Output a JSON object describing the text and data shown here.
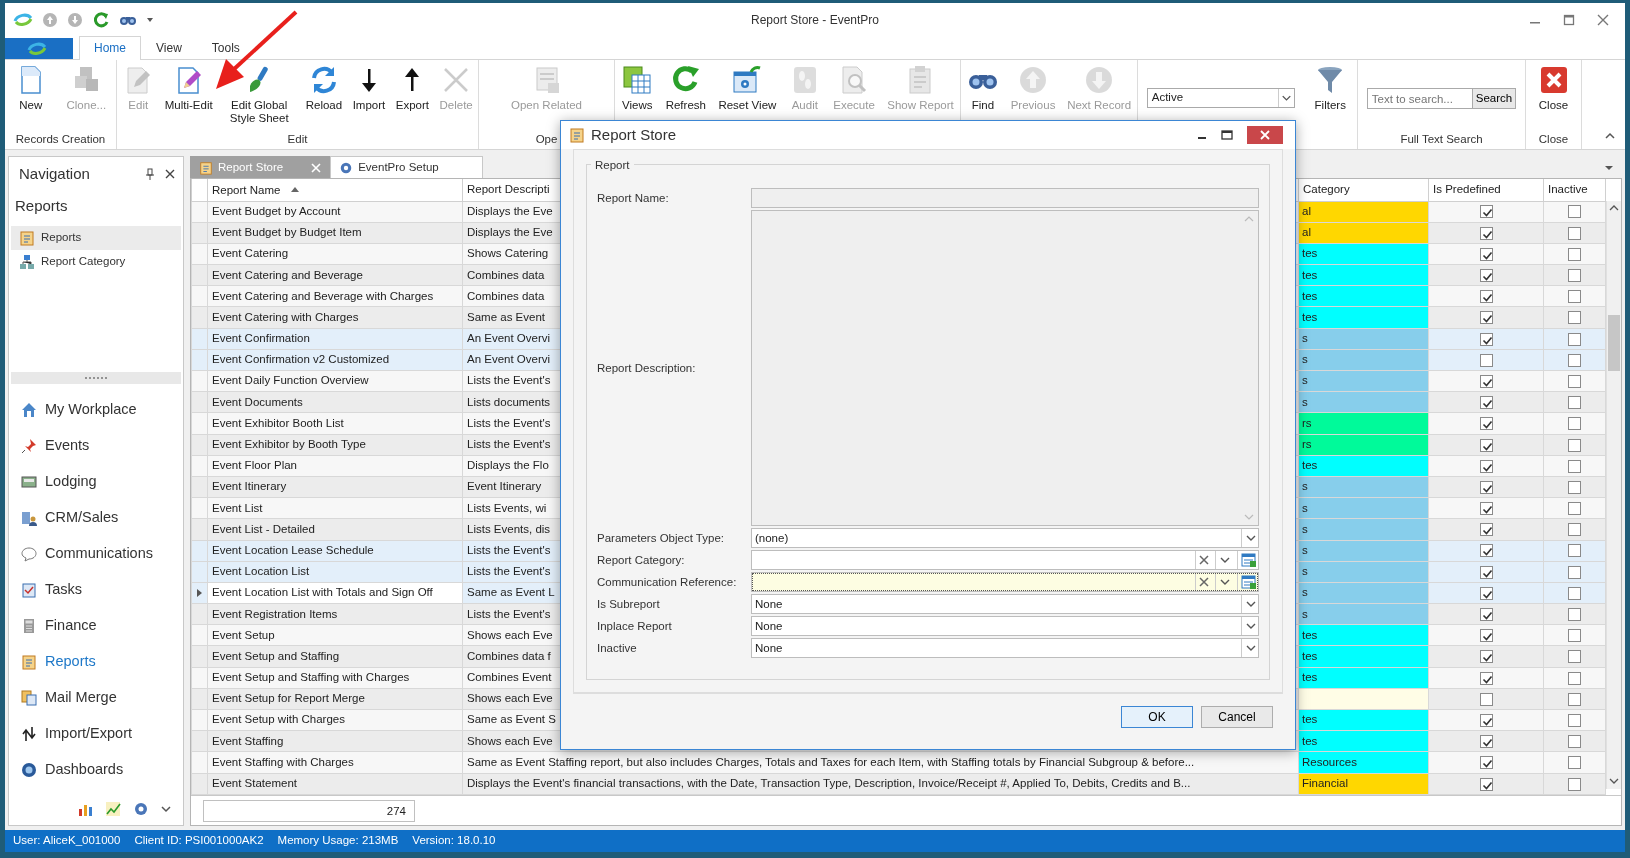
{
  "window": {
    "title": "Report Store - EventPro"
  },
  "ribbon": {
    "tabs": [
      {
        "label": "Home",
        "selected": true
      },
      {
        "label": "View",
        "selected": false
      },
      {
        "label": "Tools",
        "selected": false
      }
    ],
    "groups": [
      {
        "label": "Records Creation",
        "buttons": [
          {
            "label": "New",
            "disabled": false
          },
          {
            "label": "Clone...",
            "disabled": true
          }
        ]
      },
      {
        "label": "Edit",
        "buttons": [
          {
            "label": "Edit",
            "disabled": true
          },
          {
            "label": "Multi-Edit",
            "disabled": false
          },
          {
            "label": "Edit Global Style Sheet",
            "disabled": false
          },
          {
            "label": "Reload",
            "disabled": false
          },
          {
            "label": "Import",
            "disabled": false
          },
          {
            "label": "Export",
            "disabled": false
          },
          {
            "label": "Delete",
            "disabled": true
          }
        ]
      },
      {
        "label": "Ope",
        "buttons": [
          {
            "label": "Open Related",
            "disabled": true
          }
        ]
      },
      {
        "buttons": [
          {
            "label": "Views",
            "disabled": false
          },
          {
            "label": "Refresh",
            "disabled": false
          },
          {
            "label": "Reset View",
            "disabled": false
          },
          {
            "label": "Audit",
            "disabled": true
          },
          {
            "label": "Execute",
            "disabled": true
          },
          {
            "label": "Show Report",
            "disabled": true
          }
        ]
      },
      {
        "buttons": [
          {
            "label": "Find",
            "disabled": false
          },
          {
            "label": "Previous",
            "disabled": true
          },
          {
            "label": "Next Record",
            "disabled": true
          }
        ]
      },
      {
        "dropdown": {
          "value": "Active"
        },
        "buttons": [
          {
            "label": "Filters",
            "disabled": false
          }
        ]
      },
      {
        "label": "Full Text Search",
        "search": {
          "placeholder": "Text to search...",
          "button": "Search"
        }
      },
      {
        "label": "Close",
        "buttons": [
          {
            "label": "Close",
            "disabled": false
          }
        ]
      }
    ]
  },
  "navigation": {
    "title": "Navigation",
    "section": "Reports",
    "items": [
      {
        "label": "Reports",
        "selected": true
      },
      {
        "label": "Report Category",
        "selected": false
      }
    ],
    "modules": [
      {
        "label": "My Workplace",
        "selected": false
      },
      {
        "label": "Events",
        "selected": false
      },
      {
        "label": "Lodging",
        "selected": false
      },
      {
        "label": "CRM/Sales",
        "selected": false
      },
      {
        "label": "Communications",
        "selected": false
      },
      {
        "label": "Tasks",
        "selected": false
      },
      {
        "label": "Finance",
        "selected": false
      },
      {
        "label": "Reports",
        "selected": true
      },
      {
        "label": "Mail Merge",
        "selected": false
      },
      {
        "label": "Import/Export",
        "selected": false
      },
      {
        "label": "Dashboards",
        "selected": false
      }
    ]
  },
  "document_tabs": [
    {
      "label": "Report Store",
      "selected": true
    },
    {
      "label": "EventPro Setup",
      "selected": false
    }
  ],
  "table": {
    "columns": [
      {
        "label": "Report Name",
        "sorted": true
      },
      {
        "label": "Report Descripti",
        "sorted": false
      },
      {
        "label": "Category",
        "sorted": false
      },
      {
        "label": "Is Predefined",
        "sorted": false
      },
      {
        "label": "Inactive",
        "sorted": false
      }
    ],
    "rows": [
      {
        "name": "Event Budget by Account",
        "description": "Displays the Eve",
        "category": "al",
        "color": "#ffd700",
        "predefined": true,
        "inactive": false,
        "selected": false,
        "current": false
      },
      {
        "name": "Event Budget by Budget Item",
        "description": "Displays the Eve",
        "category": "al",
        "color": "#ffd700",
        "predefined": true,
        "inactive": false,
        "selected": false,
        "current": false
      },
      {
        "name": "Event Catering",
        "description": "Shows Catering",
        "category": "tes",
        "color": "#00ffff",
        "predefined": true,
        "inactive": false,
        "selected": false,
        "current": false
      },
      {
        "name": "Event Catering and Beverage",
        "description": "Combines data",
        "category": "tes",
        "color": "#00ffff",
        "predefined": true,
        "inactive": false,
        "selected": false,
        "current": false
      },
      {
        "name": "Event Catering and Beverage with Charges",
        "description": "Combines data",
        "category": "tes",
        "color": "#00ffff",
        "predefined": true,
        "inactive": false,
        "selected": false,
        "current": false
      },
      {
        "name": "Event Catering with Charges",
        "description": "Same as Event",
        "category": "tes",
        "color": "#00ffff",
        "predefined": true,
        "inactive": false,
        "selected": false,
        "current": false
      },
      {
        "name": "Event Confirmation",
        "description": "An Event Overvi",
        "category": "s",
        "color": "#87ceeb",
        "predefined": true,
        "inactive": false,
        "selected": true,
        "current": false
      },
      {
        "name": "Event Confirmation v2 Customized",
        "description": "An Event Overvi",
        "category": "s",
        "color": "#87ceeb",
        "predefined": false,
        "inactive": false,
        "selected": true,
        "current": false
      },
      {
        "name": "Event Daily Function Overview",
        "description": "Lists the Event's",
        "category": "s",
        "color": "#87ceeb",
        "predefined": true,
        "inactive": false,
        "selected": false,
        "current": false
      },
      {
        "name": "Event Documents",
        "description": "Lists documents",
        "category": "s",
        "color": "#87ceeb",
        "predefined": true,
        "inactive": false,
        "selected": false,
        "current": false
      },
      {
        "name": "Event Exhibitor Booth List",
        "description": "Lists the Event's",
        "category": "rs",
        "color": "#00fa9a",
        "predefined": true,
        "inactive": false,
        "selected": false,
        "current": false
      },
      {
        "name": "Event Exhibitor by Booth Type",
        "description": "Lists the Event's",
        "category": "rs",
        "color": "#00fa9a",
        "predefined": true,
        "inactive": false,
        "selected": false,
        "current": false
      },
      {
        "name": "Event Floor Plan",
        "description": "Displays the Flo",
        "category": "tes",
        "color": "#00ffff",
        "predefined": true,
        "inactive": false,
        "selected": false,
        "current": false
      },
      {
        "name": "Event Itinerary",
        "description": "Event Itinerary",
        "category": "s",
        "color": "#87ceeb",
        "predefined": true,
        "inactive": false,
        "selected": false,
        "current": false
      },
      {
        "name": "Event List",
        "description": "Lists Events, wi",
        "category": "s",
        "color": "#87ceeb",
        "predefined": true,
        "inactive": false,
        "selected": false,
        "current": false
      },
      {
        "name": "Event List - Detailed",
        "description": "Lists Events, dis",
        "category": "s",
        "color": "#87ceeb",
        "predefined": true,
        "inactive": false,
        "selected": false,
        "current": false
      },
      {
        "name": "Event Location Lease Schedule",
        "description": "Lists the Event's",
        "category": "s",
        "color": "#87ceeb",
        "predefined": true,
        "inactive": false,
        "selected": true,
        "current": false
      },
      {
        "name": "Event Location List",
        "description": "Lists the Event's",
        "category": "s",
        "color": "#87ceeb",
        "predefined": true,
        "inactive": false,
        "selected": true,
        "current": false
      },
      {
        "name": "Event Location List with Totals and Sign Off",
        "description": "Same as Event L",
        "category": "s",
        "color": "#87ceeb",
        "predefined": true,
        "inactive": false,
        "selected": true,
        "current": true
      },
      {
        "name": "Event Registration Items",
        "description": "Lists the Event's",
        "category": "s",
        "color": "#87ceeb",
        "predefined": true,
        "inactive": false,
        "selected": false,
        "current": false
      },
      {
        "name": "Event Setup",
        "description": "Shows each Eve",
        "category": "tes",
        "color": "#00ffff",
        "predefined": true,
        "inactive": false,
        "selected": false,
        "current": false
      },
      {
        "name": "Event Setup and Staffing",
        "description": "Combines data f",
        "category": "tes",
        "color": "#00ffff",
        "predefined": true,
        "inactive": false,
        "selected": false,
        "current": false
      },
      {
        "name": "Event Setup and Staffing with Charges",
        "description": "Combines Event",
        "category": "tes",
        "color": "#00ffff",
        "predefined": true,
        "inactive": false,
        "selected": false,
        "current": false
      },
      {
        "name": "Event Setup for Report Merge",
        "description": "Shows each Eve",
        "category": "",
        "color": "#fffde6",
        "predefined": false,
        "inactive": false,
        "selected": false,
        "current": false
      },
      {
        "name": "Event Setup with Charges",
        "description": "Same as Event S",
        "category": "tes",
        "color": "#00ffff",
        "predefined": true,
        "inactive": false,
        "selected": false,
        "current": false
      },
      {
        "name": "Event Staffing",
        "description": "Shows each Eve",
        "category": "tes",
        "color": "#00ffff",
        "predefined": true,
        "inactive": false,
        "selected": false,
        "current": false
      },
      {
        "name": "Event Staffing with Charges",
        "description": "Same as Event Staffing report, but also includes Charges, Totals and Taxes for each Item, with Staffing totals by Financial Subgroup & before...",
        "category": "Resources",
        "color": "#00ffff",
        "predefined": true,
        "inactive": false,
        "selected": false,
        "current": false
      },
      {
        "name": "Event Statement",
        "description": "Displays the Event's financial transactions, with the Date, Transaction Type, Description, Invoice/Receipt #, Applied To, Debits, Credits and B...",
        "category": "Financial",
        "color": "#ffd700",
        "predefined": true,
        "inactive": false,
        "selected": false,
        "current": false
      }
    ],
    "footer": {
      "count": "274"
    }
  },
  "dialog": {
    "title": "Report Store",
    "group": "Report",
    "fields": [
      {
        "label": "Report Name:",
        "kind": "text",
        "disabled": true,
        "focused": false
      },
      {
        "label": "Report Description:",
        "kind": "memo",
        "disabled": true,
        "focused": false
      },
      {
        "label": "Parameters Object Type:",
        "kind": "dropdown",
        "value": "(none)",
        "disabled": false,
        "focused": false
      },
      {
        "label": "Report Category:",
        "kind": "lookup",
        "disabled": false,
        "focused": false
      },
      {
        "label": "Communication Reference:",
        "kind": "lookup",
        "disabled": false,
        "focused": true
      },
      {
        "label": "Is Subreport",
        "kind": "dropdown",
        "value": "None",
        "disabled": false,
        "focused": false
      },
      {
        "label": "Inplace Report",
        "kind": "dropdown",
        "value": "None",
        "disabled": false,
        "focused": false
      },
      {
        "label": "Inactive",
        "kind": "dropdown",
        "value": "None",
        "disabled": false,
        "focused": false
      }
    ],
    "buttons": [
      {
        "label": "OK",
        "default": true
      },
      {
        "label": "Cancel",
        "default": false
      }
    ]
  },
  "status_bar": [
    "User: AliceK_001000",
    "Client ID: PSI001000AK2",
    "Memory Usage: 213MB",
    "Version: 18.0.10"
  ]
}
